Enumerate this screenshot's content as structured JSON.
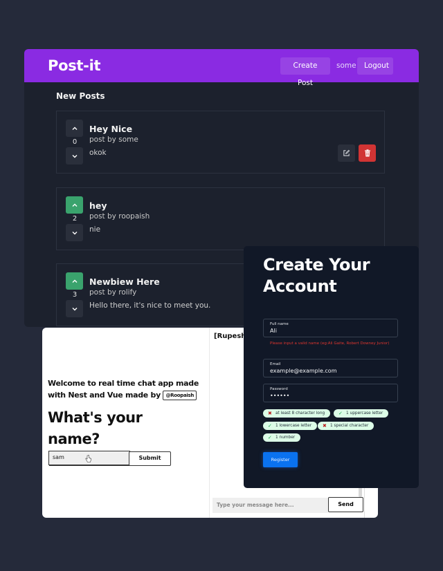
{
  "postit": {
    "logo": "Post-it",
    "nav": {
      "create_post": "Create Post",
      "username": "some",
      "logout": "Logout"
    },
    "section_title": "New Posts",
    "posts": [
      {
        "votes": "0",
        "upvoted": false,
        "title": "Hey Nice",
        "author": "post by some",
        "body": "okok",
        "owned": true
      },
      {
        "votes": "2",
        "upvoted": true,
        "title": "hey",
        "author": "post by roopaish",
        "body": "nie",
        "owned": false
      },
      {
        "votes": "3",
        "upvoted": true,
        "title": "Newbiew Here",
        "author": "post by rolify",
        "body": "Hello there, it's nice to meet you.",
        "owned": false
      }
    ],
    "colors": {
      "header": "#8a2be2",
      "upvote_active": "#3aa36d",
      "delete": "#d13434"
    }
  },
  "chat": {
    "welcome_line": "Welcome to real time chat app made with Nest and Vue made by",
    "author_handle": "@Roopaish",
    "question": "What's your name?",
    "name_input_value": "sam",
    "submit_label": "Submit",
    "right_header": "[Rupesh",
    "message_placeholder": "Type your message here...",
    "send_label": "Send"
  },
  "signup": {
    "title": "Create Your Account",
    "fields": {
      "full_name": {
        "label": "Full name",
        "value": "Ali"
      },
      "email": {
        "label": "Email",
        "value": "example@example.com"
      },
      "password": {
        "label": "Password",
        "value": "••••••"
      }
    },
    "name_error": "Please input a valid name (eg:Ali Gaite, Robert Downey Junior)",
    "requirements": [
      {
        "label": "at least 8 character long",
        "met": false,
        "icon": "✖"
      },
      {
        "label": "1 uppercase letter",
        "met": true,
        "icon": "✓"
      },
      {
        "label": "1 lowercase letter",
        "met": true,
        "icon": "✓"
      },
      {
        "label": "1 special character",
        "met": false,
        "icon": "✖"
      },
      {
        "label": "1 number",
        "met": true,
        "icon": "✓"
      }
    ],
    "register_label": "Register",
    "colors": {
      "register": "#0a72f0",
      "error": "#e0362f"
    }
  }
}
